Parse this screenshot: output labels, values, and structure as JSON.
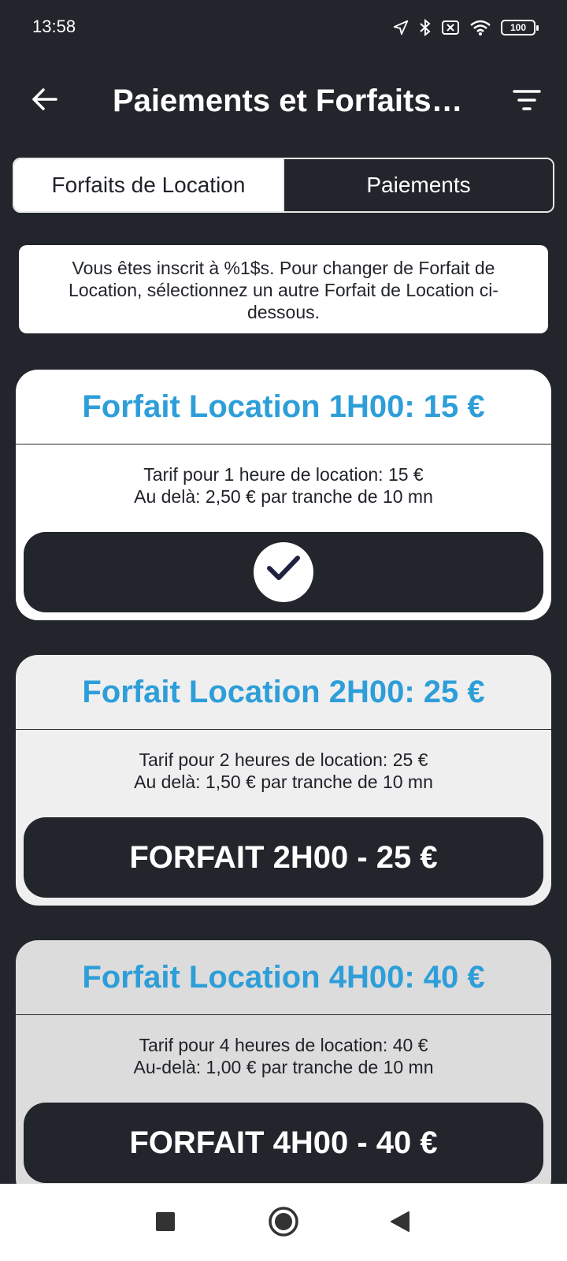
{
  "status_bar": {
    "time": "13:58",
    "battery": "100",
    "icons": [
      "location-arrow-icon",
      "bluetooth-icon",
      "sim-x-icon",
      "wifi-icon",
      "battery-icon"
    ]
  },
  "app_bar": {
    "title": "Paiements et Forfaits L...",
    "back_icon": "arrow-left-icon",
    "filter_icon": "filter-lines-icon"
  },
  "tabs": [
    {
      "label": "Forfaits de Location",
      "active": true
    },
    {
      "label": "Paiements",
      "active": false
    }
  ],
  "info": {
    "text": "Vous êtes inscrit à %1$s. Pour changer de Forfait de Location, sélectionnez un autre Forfait de Location ci-dessous."
  },
  "plans": [
    {
      "title": "Forfait Location 1H00: 15 €",
      "line1": "Tarif pour 1 heure de location: 15 €",
      "line2": "Au delà: 2,50 € par tranche de 10 mn",
      "button_label": "",
      "selected": true
    },
    {
      "title": "Forfait Location 2H00: 25 €",
      "line1": "Tarif pour 2 heures de location: 25 €",
      "line2": "Au delà: 1,50 € par tranche de 10 mn",
      "button_label": "FORFAIT 2H00 - 25 €",
      "selected": false
    },
    {
      "title": "Forfait Location 4H00: 40 €",
      "line1": "Tarif pour 4 heures de location: 40 €",
      "line2": "Au-delà: 1,00 € par tranche de 10 mn",
      "button_label": "FORFAIT 4H00 - 40 €",
      "selected": false
    }
  ],
  "nav_bar": {
    "icons": [
      "recents-square-icon",
      "home-circle-icon",
      "back-triangle-icon"
    ]
  },
  "colors": {
    "background": "#22252b",
    "accent": "#2e9ed9",
    "card_selected": "#ffffff",
    "card_2": "#efefef",
    "card_3": "#dcdcdc"
  }
}
